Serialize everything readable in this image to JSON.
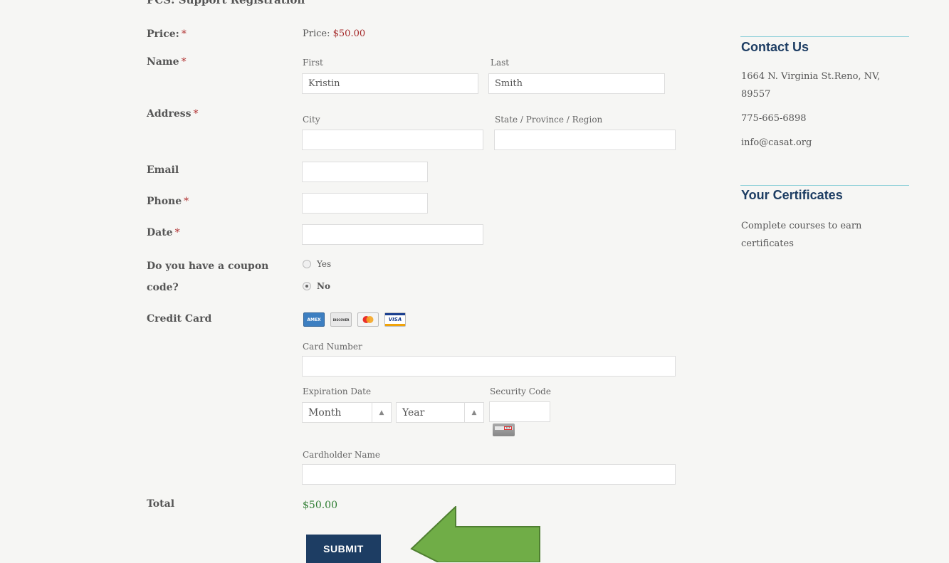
{
  "form": {
    "heading_partial": "PCS: Support Registration",
    "price": {
      "label": "Price:",
      "required": "*",
      "prefix": "Price:",
      "value": "$50.00"
    },
    "name": {
      "label": "Name",
      "required": "*",
      "first_label": "First",
      "first_value": "Kristin",
      "last_label": "Last",
      "last_value": "Smith"
    },
    "address": {
      "label": "Address",
      "required": "*",
      "city_label": "City",
      "city_value": "",
      "state_label": "State / Province / Region",
      "state_value": ""
    },
    "email": {
      "label": "Email",
      "value": ""
    },
    "phone": {
      "label": "Phone",
      "required": "*",
      "value": ""
    },
    "date": {
      "label": "Date",
      "required": "*",
      "value": ""
    },
    "coupon": {
      "label_line1": "Do you have a coupon",
      "label_line2": "code?",
      "options": [
        "Yes",
        "No"
      ],
      "selected": "No"
    },
    "credit_card": {
      "label": "Credit Card",
      "card_types": [
        "AMEX",
        "DISCOVER",
        "MasterCard",
        "VISA"
      ],
      "card_number_label": "Card Number",
      "card_number_value": "",
      "expiration_label": "Expiration Date",
      "month_value": "Month",
      "year_value": "Year",
      "security_label": "Security Code",
      "security_value": "",
      "cvv_hint": "123",
      "cardholder_label": "Cardholder Name",
      "cardholder_value": ""
    },
    "total": {
      "label": "Total",
      "value": "$50.00"
    },
    "submit_label": "SUBMIT"
  },
  "sidebar": {
    "contact": {
      "title": "Contact Us",
      "address_line1": "1664 N. Virginia St.Reno, NV,",
      "address_line2": "89557",
      "phone": "775-665-6898",
      "email": "info@casat.org"
    },
    "certificates": {
      "title": "Your Certificates",
      "text_line1": "Complete courses to earn",
      "text_line2": "certificates"
    }
  },
  "colors": {
    "accent_navy": "#1d3d63",
    "rule_teal": "#8fd0d9",
    "price_red": "#a52a2a",
    "total_green": "#2e7d32",
    "arrow_green": "#70ad47"
  }
}
